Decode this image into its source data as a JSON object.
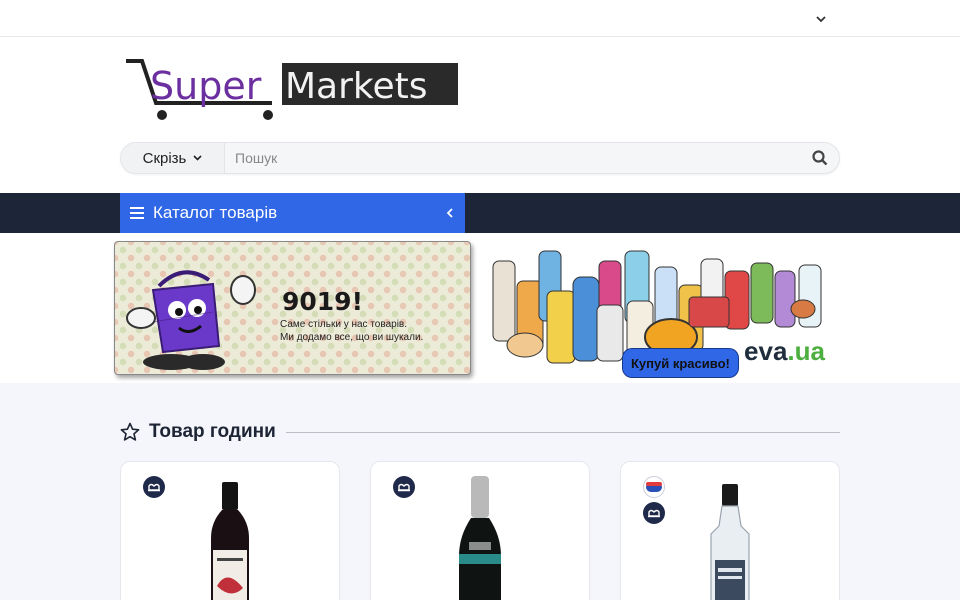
{
  "header": {
    "brand_part1": "Super",
    "brand_part2": "Markets"
  },
  "search": {
    "scope_label": "Скрізь",
    "placeholder": "Пошук"
  },
  "nav": {
    "catalog_label": "Каталог товарів"
  },
  "banners": {
    "promo_count": "9019!",
    "promo_line1": "Саме стільки у нас товарів.",
    "promo_line2": "Ми додамо все, що ви шукали.",
    "eva_brand": "eva",
    "eva_domain": ".ua",
    "cta_label": "Купуй красиво!"
  },
  "section": {
    "title": "Товар години"
  },
  "colors": {
    "accent": "#2f67e7",
    "navbar": "#1d2638",
    "eva_green": "#4cae3f",
    "logo_purple": "#6b2fa0"
  },
  "products": [
    {
      "store_icons": [
        "silpo-store-icon"
      ],
      "bottle": "red-wine-bottle"
    },
    {
      "store_icons": [
        "silpo-store-icon"
      ],
      "bottle": "sparkling-wine-bottle"
    },
    {
      "store_icons": [
        "atb-store-icon",
        "silpo-store-icon"
      ],
      "bottle": "vodka-bottle"
    }
  ]
}
